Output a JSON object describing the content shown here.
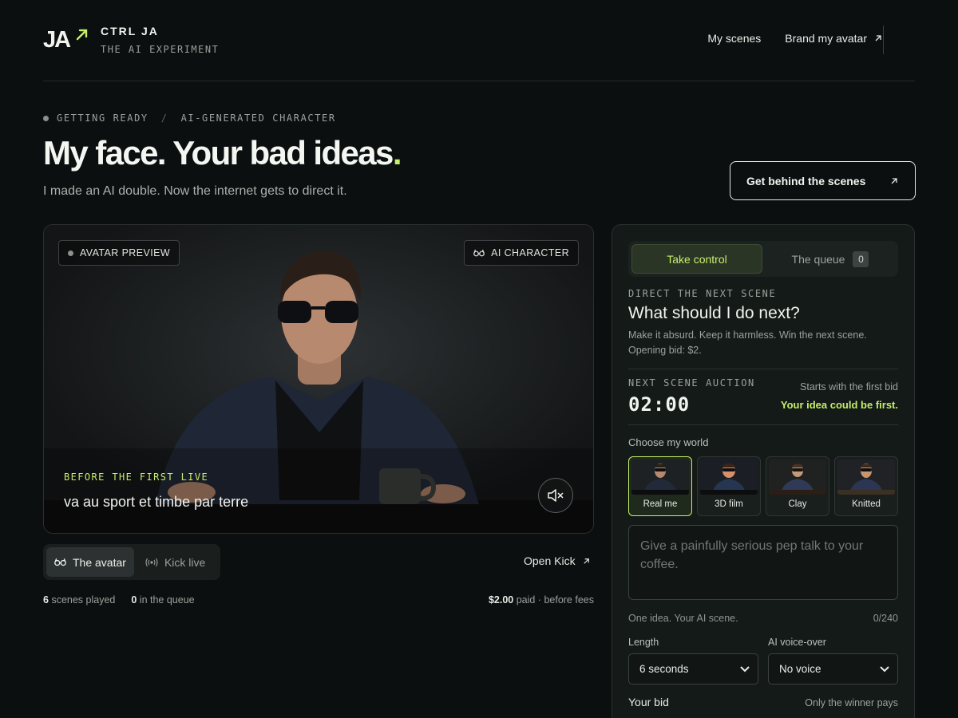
{
  "header": {
    "logo": "JA",
    "brand_name": "CTRL JA",
    "brand_sub": "THE AI EXPERIMENT",
    "nav": [
      {
        "label": "My scenes"
      },
      {
        "label": "Brand my avatar"
      }
    ]
  },
  "hero": {
    "crumb_status": "GETTING READY",
    "crumb_sep": "/",
    "crumb_type": "AI-GENERATED CHARACTER",
    "title_main": "My face. Your bad ideas",
    "title_accent": ".",
    "subtitle": "I made an AI double. Now the internet gets to direct it.",
    "cta_label": "Get behind the scenes"
  },
  "video": {
    "badge_left": "AVATAR PREVIEW",
    "badge_right": "AI CHARACTER",
    "overlay_label": "BEFORE THE FIRST LIVE",
    "caption": "va au sport et timbe par terre"
  },
  "below_video": {
    "toggle": [
      {
        "label": "The avatar",
        "active": true
      },
      {
        "label": "Kick live",
        "active": false
      }
    ],
    "open_kick": "Open Kick",
    "scenes_count": "6",
    "scenes_label": "scenes played",
    "queue_count": "0",
    "queue_label": "in the queue",
    "paid_amount": "$2.00",
    "paid_label": "paid · before fees"
  },
  "panel": {
    "tabs": [
      {
        "label": "Take control",
        "active": true
      },
      {
        "label": "The queue",
        "badge": "0",
        "active": false
      }
    ],
    "kicker": "DIRECT THE NEXT SCENE",
    "title": "What should I do next?",
    "desc_line1": "Make it absurd. Keep it harmless. Win the next scene.",
    "desc_line2": "Opening bid: $2.",
    "auction": {
      "kicker": "NEXT SCENE AUCTION",
      "timer": "02:00",
      "starts": "Starts with the first bid",
      "first": "Your idea could be first."
    },
    "world_label": "Choose my world",
    "worlds": [
      {
        "name": "Real me",
        "active": true
      },
      {
        "name": "3D film",
        "active": false
      },
      {
        "name": "Clay",
        "active": false
      },
      {
        "name": "Knitted",
        "active": false
      }
    ],
    "idea_placeholder": "Give a painfully serious pep talk to your coffee.",
    "idea_hint": "One idea. Your AI scene.",
    "idea_counter": "0/240",
    "length_label": "Length",
    "length_value": "6 seconds",
    "voice_label": "AI voice-over",
    "voice_value": "No voice",
    "bid_label": "Your bid",
    "bid_note": "Only the winner pays"
  },
  "colors": {
    "accent": "#c6ef6a",
    "background": "#0b0f0f",
    "panel": "#141a18"
  }
}
